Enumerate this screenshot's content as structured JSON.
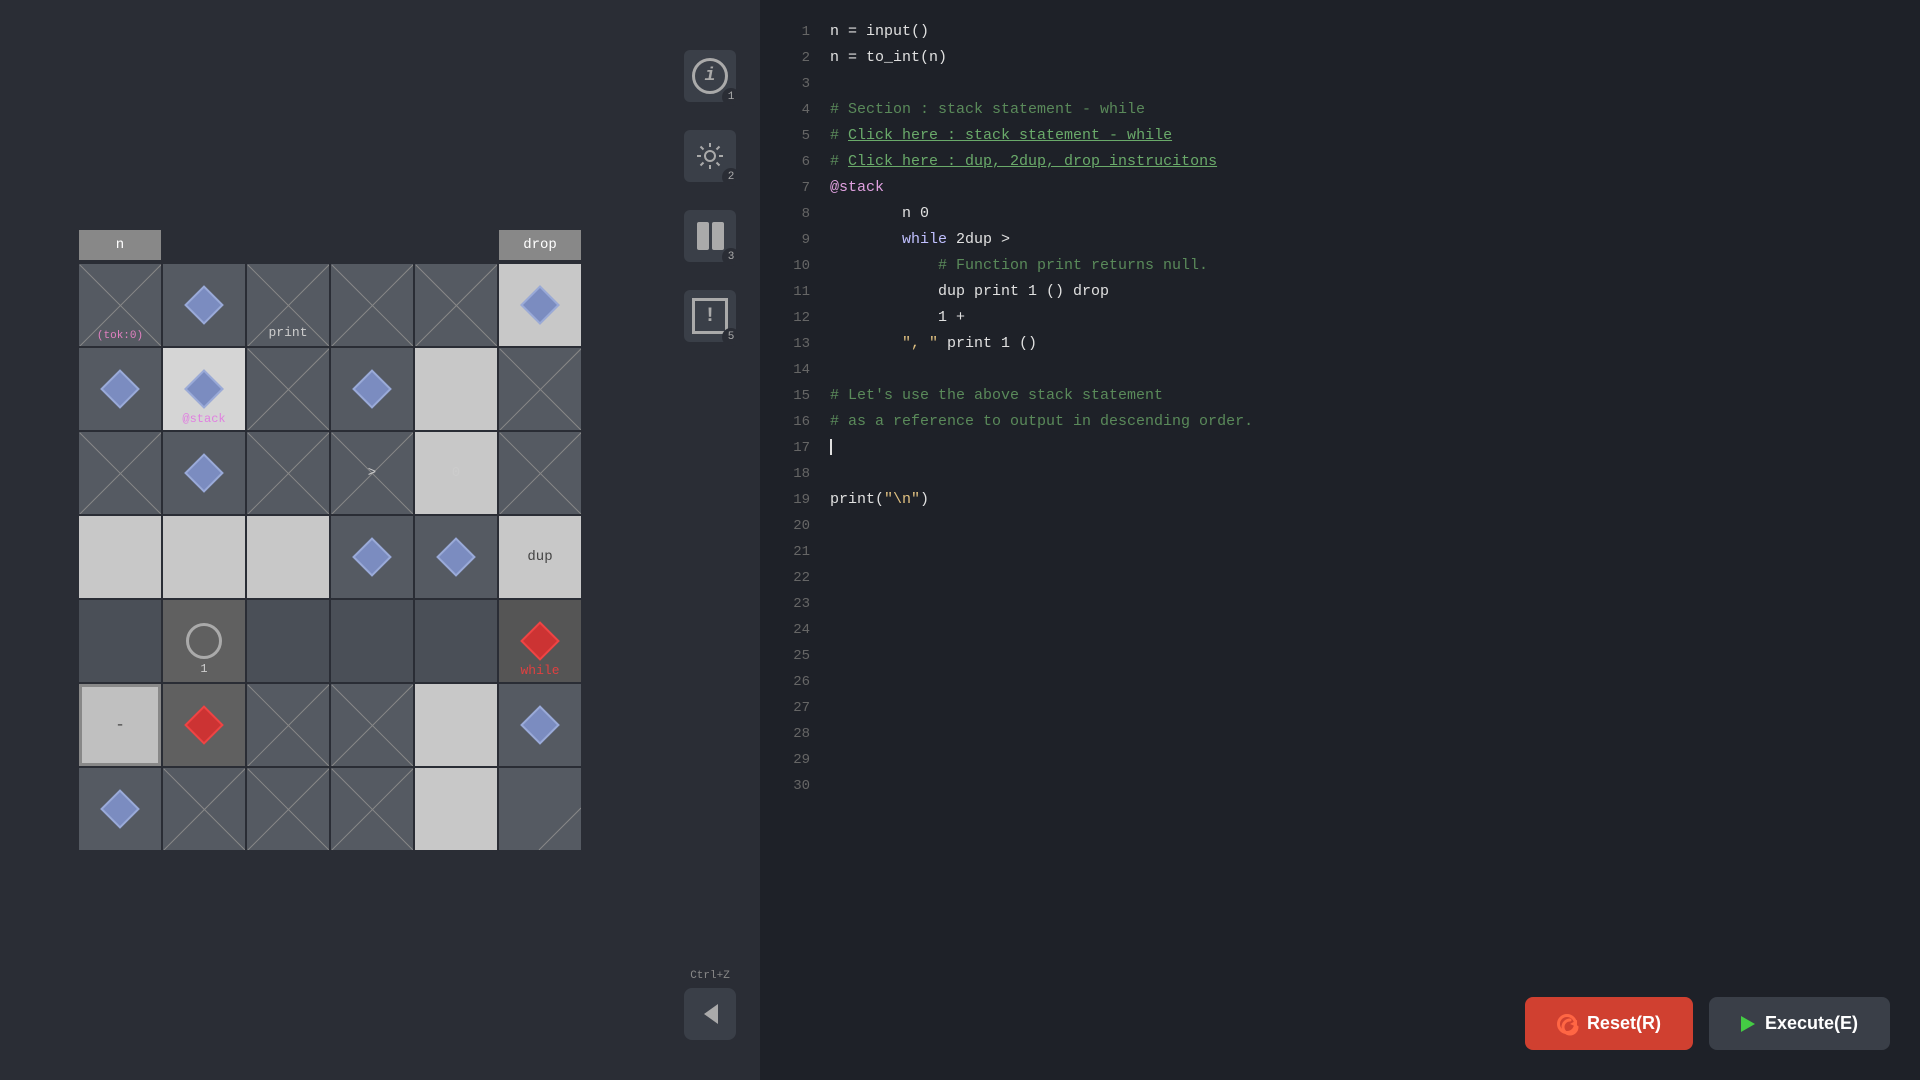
{
  "left_panel": {
    "grid_headers": [
      {
        "label": "n",
        "active": true
      },
      {
        "label": "",
        "active": false
      },
      {
        "label": "",
        "active": false
      },
      {
        "label": "",
        "active": false
      },
      {
        "label": "",
        "active": false
      },
      {
        "label": "drop",
        "active": true
      }
    ],
    "grid": [
      [
        {
          "type": "diagonal",
          "label": "(tok:0)",
          "label_class": "pink"
        },
        {
          "type": "diamond",
          "color": "blue"
        },
        {
          "type": "diagonal"
        },
        {
          "type": "diagonal"
        },
        {
          "type": "diagonal"
        },
        {
          "type": "diamond-cell",
          "color": "blue",
          "bg": "light"
        }
      ],
      [
        {
          "type": "diamond",
          "color": "blue"
        },
        {
          "type": "diamond-label",
          "color": "blue",
          "label": "@stack"
        },
        {
          "type": "diagonal"
        },
        {
          "type": "diamond",
          "color": "blue"
        },
        {
          "type": "light"
        },
        {
          "type": "diagonal"
        }
      ],
      [
        {
          "type": "diagonal"
        },
        {
          "type": "diamond",
          "color": "blue"
        },
        {
          "type": "diagonal"
        },
        {
          "type": "diagonal"
        },
        {
          "type": "label-cell",
          "label": "0"
        },
        {
          "type": "diagonal"
        }
      ],
      [
        {
          "type": "light"
        },
        {
          "type": "light"
        },
        {
          "type": "light"
        },
        {
          "type": "diamond",
          "color": "blue"
        },
        {
          "type": "diamond",
          "color": "blue"
        },
        {
          "type": "label-cell",
          "label": "dup",
          "bg": "light"
        }
      ],
      [
        {
          "type": "dark"
        },
        {
          "type": "circle"
        },
        {
          "type": "dark"
        },
        {
          "type": "dark"
        },
        {
          "type": "dark"
        },
        {
          "type": "label-cell",
          "label": "while",
          "color": "red-diamond"
        }
      ],
      [
        {
          "type": "light-bg"
        },
        {
          "type": "red-diamond"
        },
        {
          "type": "diagonal"
        },
        {
          "type": "diagonal"
        },
        {
          "type": "light"
        },
        {
          "type": "diamond",
          "color": "blue"
        }
      ],
      [
        {
          "type": "diamond",
          "color": "blue"
        },
        {
          "type": "diagonal"
        },
        {
          "type": "diagonal"
        },
        {
          "type": "diagonal"
        },
        {
          "type": "light"
        },
        {
          "type": "diagonal"
        }
      ]
    ]
  },
  "middle_panel": {
    "buttons": [
      {
        "id": "info",
        "badge": "1",
        "icon": "info"
      },
      {
        "id": "settings",
        "badge": "2",
        "icon": "gear"
      },
      {
        "id": "layout",
        "badge": "3",
        "icon": "layout"
      },
      {
        "id": "warning",
        "badge": "5",
        "icon": "warning"
      }
    ],
    "back_shortcut": "Ctrl+Z",
    "back_label": "Back"
  },
  "code_editor": {
    "lines": [
      {
        "num": 1,
        "content": "n = input()"
      },
      {
        "num": 2,
        "content": "n = to_int(n)"
      },
      {
        "num": 3,
        "content": ""
      },
      {
        "num": 4,
        "content": "# Section : stack statement - while",
        "type": "comment"
      },
      {
        "num": 5,
        "content": "# Click here : stack statement - while",
        "type": "comment-link"
      },
      {
        "num": 6,
        "content": "# Click here : dup, 2dup, drop instrucitons",
        "type": "comment-link"
      },
      {
        "num": 7,
        "content": "@stack",
        "type": "at"
      },
      {
        "num": 8,
        "content": "    n 0",
        "type": "normal"
      },
      {
        "num": 9,
        "content": "    while 2dup >",
        "type": "keyword"
      },
      {
        "num": 10,
        "content": "        # Function print returns null.",
        "type": "comment"
      },
      {
        "num": 11,
        "content": "        dup print 1 () drop",
        "type": "normal"
      },
      {
        "num": 12,
        "content": "        1 +",
        "type": "normal"
      },
      {
        "num": 13,
        "content": "    \", \" print 1 ()",
        "type": "normal"
      },
      {
        "num": 14,
        "content": ""
      },
      {
        "num": 15,
        "content": "# Let's use the above stack statement",
        "type": "comment"
      },
      {
        "num": 16,
        "content": "# as a reference to output in descending order.",
        "type": "comment"
      },
      {
        "num": 17,
        "content": "|",
        "type": "cursor"
      },
      {
        "num": 18,
        "content": ""
      },
      {
        "num": 19,
        "content": "print(\"\\n\")",
        "type": "normal"
      },
      {
        "num": 20,
        "content": ""
      },
      {
        "num": 21,
        "content": ""
      },
      {
        "num": 22,
        "content": ""
      },
      {
        "num": 23,
        "content": ""
      },
      {
        "num": 24,
        "content": ""
      },
      {
        "num": 25,
        "content": ""
      },
      {
        "num": 26,
        "content": ""
      },
      {
        "num": 27,
        "content": ""
      },
      {
        "num": 28,
        "content": ""
      },
      {
        "num": 29,
        "content": ""
      },
      {
        "num": 30,
        "content": ""
      }
    ],
    "reset_label": "Reset(R)",
    "execute_label": "Execute(E)"
  },
  "grid_cell_labels": {
    "print": "print",
    "at_stack": "@stack",
    "greater": ">",
    "zero": "0",
    "dup": "dup",
    "while": "while",
    "tok": "(tok:0)"
  }
}
